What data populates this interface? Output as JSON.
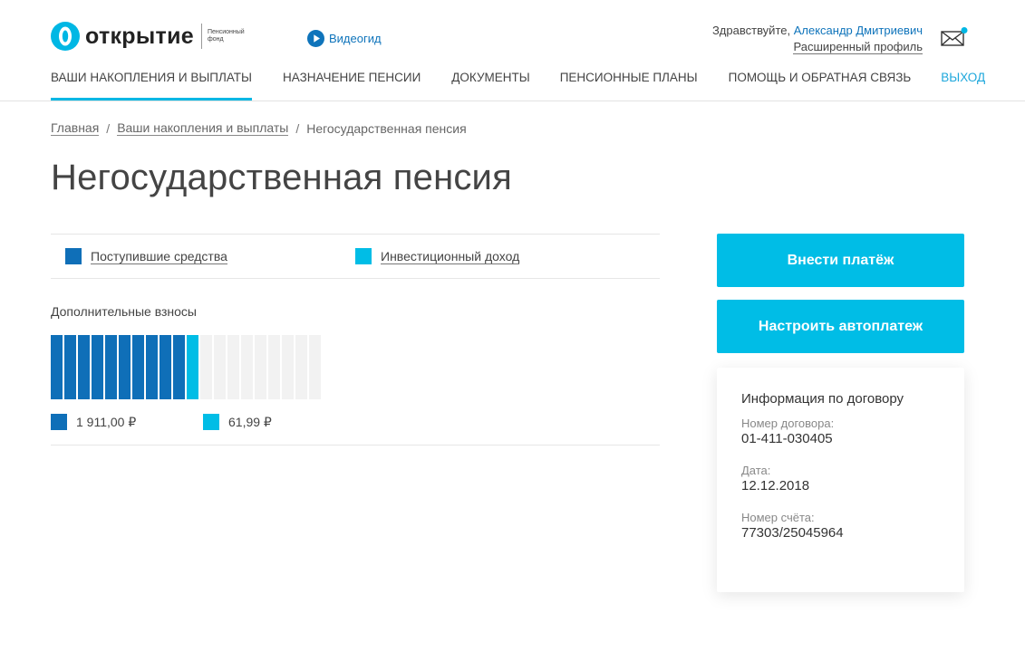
{
  "header": {
    "logo": {
      "name": "открытие",
      "sub": "Пенсионный фонд"
    },
    "videogid_label": "Видеогид",
    "greeting_prefix": "Здравствуйте, ",
    "user_name": "Александр Дмитриевич",
    "profile_link": "Расширенный профиль"
  },
  "nav": {
    "items": [
      {
        "label": "ВАШИ НАКОПЛЕНИЯ И ВЫПЛАТЫ",
        "active": true
      },
      {
        "label": "НАЗНАЧЕНИЕ ПЕНСИИ"
      },
      {
        "label": "ДОКУМЕНТЫ"
      },
      {
        "label": "ПЕНСИОННЫЕ ПЛАНЫ"
      },
      {
        "label": "ПОМОЩЬ И ОБРАТНАЯ СВЯЗЬ"
      },
      {
        "label": "ВЫХОД"
      }
    ]
  },
  "breadcrumb": {
    "items": [
      "Главная",
      "Ваши накопления и выплаты",
      "Негосударственная пенсия"
    ],
    "separator": "/"
  },
  "page_title": "Негосударственная пенсия",
  "legend": {
    "items": [
      {
        "label": "Поступившие средства",
        "color": "#0f6fb8"
      },
      {
        "label": "Инвестиционный доход",
        "color": "#00bde6"
      }
    ]
  },
  "contributions": {
    "label": "Дополнительные взносы",
    "values": [
      {
        "text": "1 911,00 ₽",
        "color": "#0f6fb8"
      },
      {
        "text": "61,99 ₽",
        "color": "#00bde6"
      }
    ]
  },
  "chart_data": {
    "type": "bar",
    "segments_total": 20,
    "segments": {
      "received": 10,
      "income": 1,
      "empty": 9
    },
    "series": [
      {
        "name": "Поступившие средства",
        "value": 1911.0,
        "color": "#0f6fb8"
      },
      {
        "name": "Инвестиционный доход",
        "value": 61.99,
        "color": "#00bde6"
      }
    ],
    "empty_color": "#f2f2f2"
  },
  "actions": {
    "pay_button": "Внести платёж",
    "autopay_button": "Настроить автоплатеж"
  },
  "contract_info": {
    "title": "Информация по договору",
    "fields": [
      {
        "label": "Номер договора:",
        "value": "01-411-030405"
      },
      {
        "label": "Дата:",
        "value": "12.12.2018"
      },
      {
        "label": "Номер счёта:",
        "value": "77303/25045964"
      }
    ]
  },
  "colors": {
    "accent": "#00bde6",
    "brand_blue": "#0f74bb",
    "dark_blue": "#0f6fb8"
  }
}
